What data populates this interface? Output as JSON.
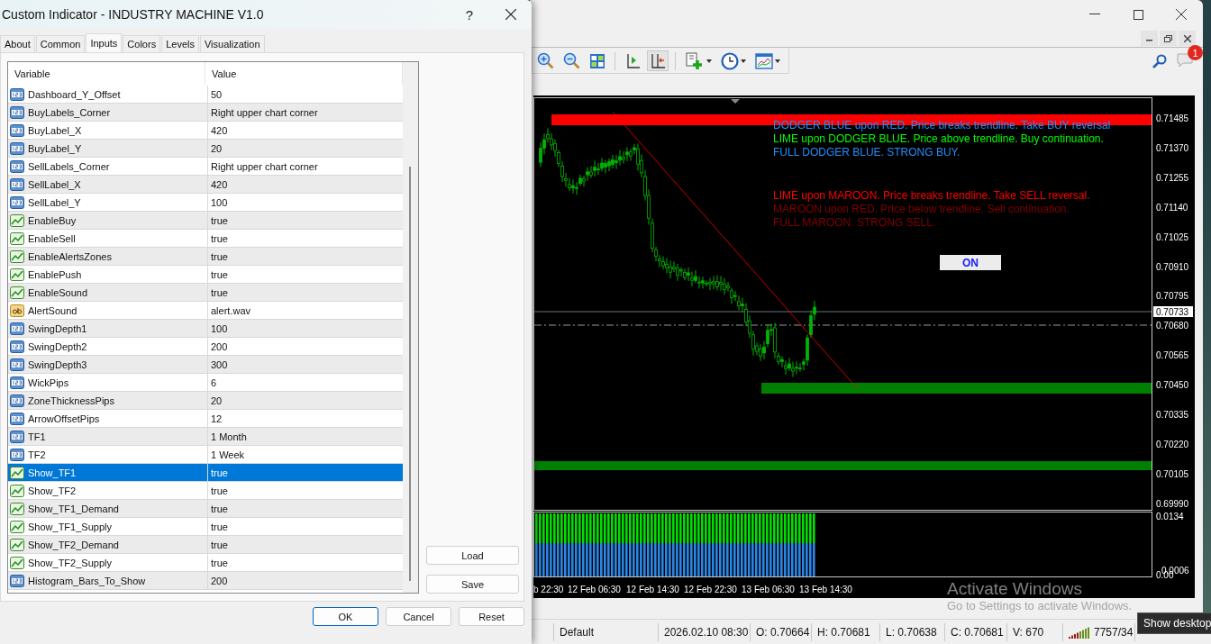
{
  "dialog": {
    "title": "Custom Indicator - INDUSTRY MACHINE V1.0",
    "help": "?",
    "tabs": [
      {
        "label": "About",
        "selected": false
      },
      {
        "label": "Common",
        "selected": false
      },
      {
        "label": "Inputs",
        "selected": true
      },
      {
        "label": "Colors",
        "selected": false
      },
      {
        "label": "Levels",
        "selected": false
      },
      {
        "label": "Visualization",
        "selected": false
      }
    ],
    "table": {
      "columns": [
        "Variable",
        "Value"
      ],
      "rows": [
        {
          "kind": "int",
          "variable": "Dashboard_Y_Offset",
          "value": "50",
          "selected": false
        },
        {
          "kind": "int",
          "variable": "BuyLabels_Corner",
          "value": "Right upper chart corner",
          "selected": false
        },
        {
          "kind": "int",
          "variable": "BuyLabel_X",
          "value": "420",
          "selected": false
        },
        {
          "kind": "int",
          "variable": "BuyLabel_Y",
          "value": "20",
          "selected": false
        },
        {
          "kind": "int",
          "variable": "SellLabels_Corner",
          "value": "Right upper chart corner",
          "selected": false
        },
        {
          "kind": "int",
          "variable": "SellLabel_X",
          "value": "420",
          "selected": false
        },
        {
          "kind": "int",
          "variable": "SellLabel_Y",
          "value": "100",
          "selected": false
        },
        {
          "kind": "bool",
          "variable": "EnableBuy",
          "value": "true",
          "selected": false
        },
        {
          "kind": "bool",
          "variable": "EnableSell",
          "value": "true",
          "selected": false
        },
        {
          "kind": "bool",
          "variable": "EnableAlertsZones",
          "value": "true",
          "selected": false
        },
        {
          "kind": "bool",
          "variable": "EnablePush",
          "value": "true",
          "selected": false
        },
        {
          "kind": "bool",
          "variable": "EnableSound",
          "value": "true",
          "selected": false
        },
        {
          "kind": "string",
          "variable": "AlertSound",
          "value": "alert.wav",
          "selected": false
        },
        {
          "kind": "int",
          "variable": "SwingDepth1",
          "value": "100",
          "selected": false
        },
        {
          "kind": "int",
          "variable": "SwingDepth2",
          "value": "200",
          "selected": false
        },
        {
          "kind": "int",
          "variable": "SwingDepth3",
          "value": "300",
          "selected": false
        },
        {
          "kind": "int",
          "variable": "WickPips",
          "value": "6",
          "selected": false
        },
        {
          "kind": "int",
          "variable": "ZoneThicknessPips",
          "value": "20",
          "selected": false
        },
        {
          "kind": "int",
          "variable": "ArrowOffsetPips",
          "value": "12",
          "selected": false
        },
        {
          "kind": "int",
          "variable": "TF1",
          "value": "1 Month",
          "selected": false
        },
        {
          "kind": "int",
          "variable": "TF2",
          "value": "1 Week",
          "selected": false
        },
        {
          "kind": "bool",
          "variable": "Show_TF1",
          "value": "true",
          "selected": true
        },
        {
          "kind": "bool",
          "variable": "Show_TF2",
          "value": "true",
          "selected": false
        },
        {
          "kind": "bool",
          "variable": "Show_TF1_Demand",
          "value": "true",
          "selected": false
        },
        {
          "kind": "bool",
          "variable": "Show_TF1_Supply",
          "value": "true",
          "selected": false
        },
        {
          "kind": "bool",
          "variable": "Show_TF2_Demand",
          "value": "true",
          "selected": false
        },
        {
          "kind": "bool",
          "variable": "Show_TF2_Supply",
          "value": "true",
          "selected": false
        },
        {
          "kind": "int",
          "variable": "Histogram_Bars_To_Show",
          "value": "200",
          "selected": false
        }
      ]
    },
    "side_buttons": [
      "Load",
      "Save"
    ],
    "buttons": [
      {
        "label": "OK",
        "default": true
      },
      {
        "label": "Cancel",
        "default": false
      },
      {
        "label": "Reset",
        "default": false
      }
    ]
  },
  "terminal": {
    "toolbar": [
      {
        "kind": "zoom-in",
        "pressed": false
      },
      {
        "kind": "zoom-out",
        "pressed": false
      },
      {
        "kind": "tile",
        "pressed": false
      },
      {
        "kind": "shift",
        "pressed": false
      },
      {
        "kind": "autoscroll",
        "pressed": true
      },
      {
        "kind": "indicator",
        "pressed": false
      },
      {
        "kind": "clock",
        "pressed": false
      },
      {
        "kind": "template",
        "pressed": false
      }
    ],
    "notification_count": "1"
  },
  "chart": {
    "price_labels": [
      "0.71485",
      "0.71370",
      "0.71255",
      "0.71140",
      "0.71025",
      "0.70910",
      "0.70795",
      "0.70680",
      "0.70565",
      "0.70450",
      "0.70335",
      "0.70220",
      "0.70105",
      "0.69990"
    ],
    "current_price": "0.70733",
    "buy_notes": [
      {
        "text": "DODGER BLUE upon RED. Price breaks trendline. Take BUY reversal",
        "color": "#1e90ff"
      },
      {
        "text": "LIME upon DODGER BLUE. Price above trendline. Buy continuation.",
        "color": "#00ff00"
      },
      {
        "text": "FULL DODGER BLUE. STRONG BUY.",
        "color": "#1e90ff"
      }
    ],
    "sell_notes": [
      {
        "text": "LIME upon MAROON. Price breaks trendline. Take SELL reversal.",
        "color": "#ff0000"
      },
      {
        "text": "MAROON upon RED. Price below trendline. Sell continuation.",
        "color": "#800000"
      },
      {
        "text": "FULL MAROON. STRONG SELL.",
        "color": "#800000"
      }
    ],
    "on_button": "ON",
    "indicator_labels": [
      "0.0134",
      "0.0006",
      "0.00"
    ],
    "time_labels": [
      "b 22:30",
      "12 Feb 06:30",
      "12 Feb 14:30",
      "12 Feb 22:30",
      "13 Feb 06:30",
      "13 Feb 14:30"
    ]
  },
  "status_bar": [
    "Default",
    "2026.02.10 08:30",
    "O: 0.70664",
    "H: 0.70681",
    "L: 0.70638",
    "C: 0.70681",
    "V: 670",
    "7757/34"
  ],
  "activation": {
    "title": "Activate Windows",
    "text": "Go to Settings to activate Windows."
  },
  "tooltip": "Show desktop"
}
